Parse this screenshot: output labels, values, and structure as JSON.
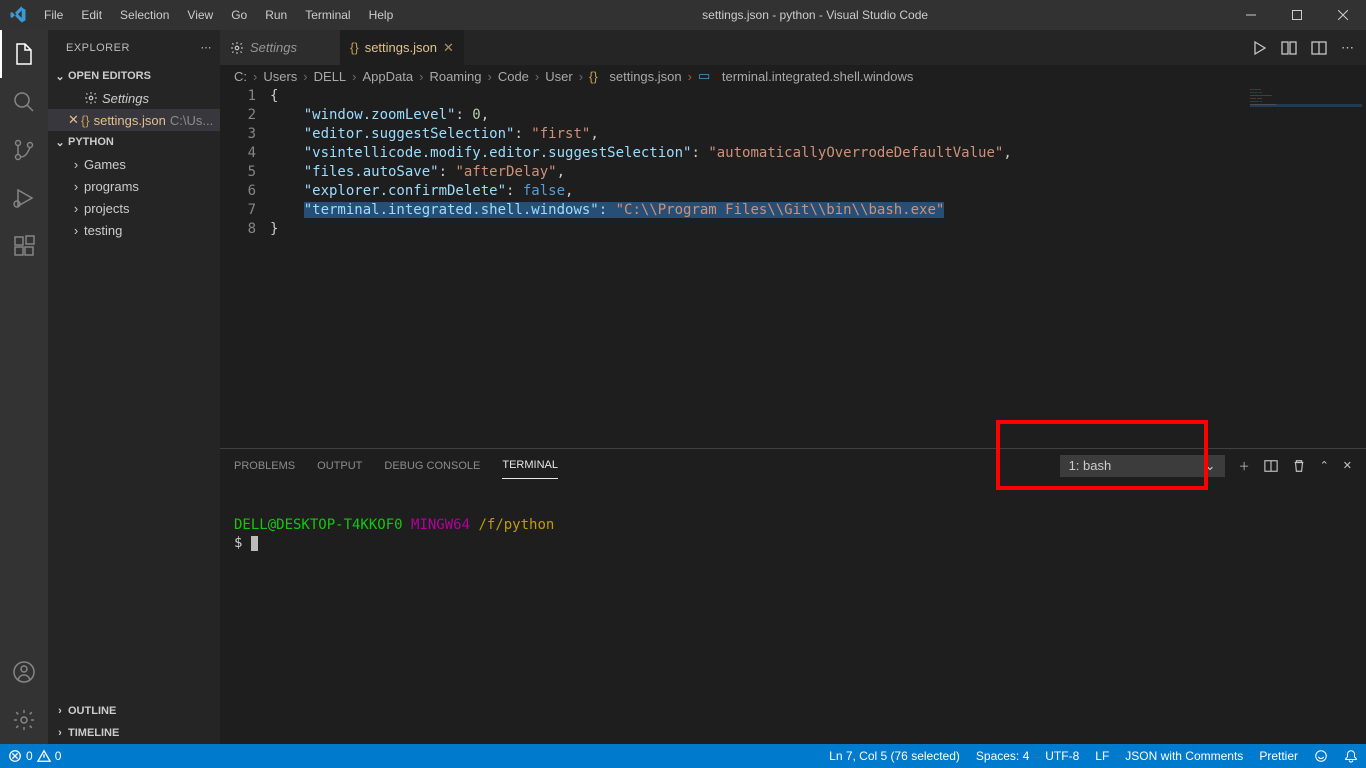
{
  "window": {
    "title": "settings.json - python - Visual Studio Code"
  },
  "menu": [
    "File",
    "Edit",
    "Selection",
    "View",
    "Go",
    "Run",
    "Terminal",
    "Help"
  ],
  "explorer": {
    "title": "EXPLORER",
    "open_editors_label": "OPEN EDITORS",
    "open_editors": [
      {
        "label": "Settings"
      },
      {
        "label": "settings.json",
        "path": "C:\\Us..."
      }
    ],
    "workspace_label": "PYTHON",
    "folders": [
      "Games",
      "programs",
      "projects",
      "testing"
    ],
    "outline_label": "OUTLINE",
    "timeline_label": "TIMELINE"
  },
  "tabs": [
    {
      "label": "Settings",
      "icon": "gear",
      "italic": true
    },
    {
      "label": "settings.json",
      "icon": "braces",
      "active": true
    }
  ],
  "breadcrumbs": [
    "C:",
    "Users",
    "DELL",
    "AppData",
    "Roaming",
    "Code",
    "User",
    "settings.json",
    "terminal.integrated.shell.windows"
  ],
  "editor": {
    "lines": [
      "1",
      "2",
      "3",
      "4",
      "5",
      "6",
      "7",
      "8"
    ],
    "content": {
      "l1": "{",
      "l2_key": "\"window.zoomLevel\"",
      "l2_val": "0",
      "l3_key": "\"editor.suggestSelection\"",
      "l3_val": "\"first\"",
      "l4_key": "\"vsintellicode.modify.editor.suggestSelection\"",
      "l4_val": "\"automaticallyOverrodeDefaultValue\"",
      "l5_key": "\"files.autoSave\"",
      "l5_val": "\"afterDelay\"",
      "l6_key": "\"explorer.confirmDelete\"",
      "l6_val": "false",
      "l7_key": "\"terminal.integrated.shell.windows\"",
      "l7_val": "\"C:\\\\Program Files\\\\Git\\\\bin\\\\bash.exe\"",
      "l8": "}"
    }
  },
  "panel": {
    "tabs": [
      "PROBLEMS",
      "OUTPUT",
      "DEBUG CONSOLE",
      "TERMINAL"
    ],
    "active_tab": "TERMINAL",
    "terminal_select": "1: bash",
    "prompt_user": "DELL@DESKTOP-T4KKOF0",
    "prompt_sys": "MINGW64",
    "prompt_path": "/f/python",
    "prompt_sym": "$"
  },
  "status": {
    "errors": "0",
    "warnings": "0",
    "cursor": "Ln 7, Col 5 (76 selected)",
    "spaces": "Spaces: 4",
    "encoding": "UTF-8",
    "eol": "LF",
    "lang": "JSON with Comments",
    "prettier": "Prettier"
  }
}
